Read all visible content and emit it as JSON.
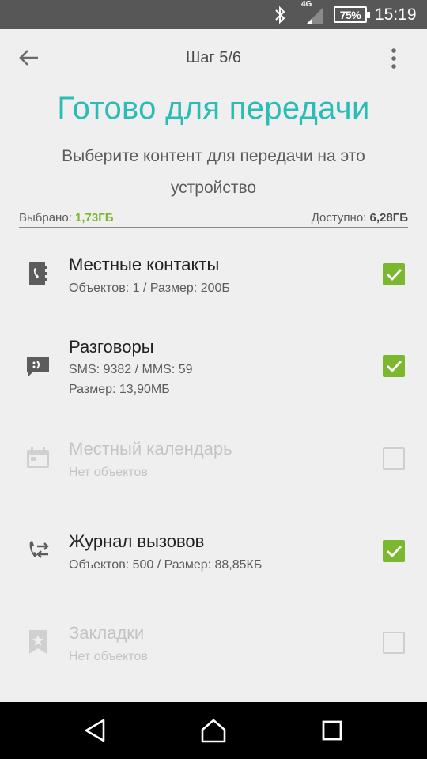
{
  "status_bar": {
    "network": "4G",
    "battery": "75%",
    "time": "15:19"
  },
  "toolbar": {
    "step": "Шаг 5/6"
  },
  "header": {
    "title": "Готово для передачи",
    "subtitle": "Выберите контент для передачи на это устройство"
  },
  "storage": {
    "selected_label": "Выбрано:",
    "selected_value": "1,73ГБ",
    "available_label": "Доступно:",
    "available_value": "6,28ГБ"
  },
  "items": [
    {
      "title": "Местные контакты",
      "sub1": "Объектов: 1 / Размер: 200Б",
      "checked": true,
      "icon": "contacts-icon"
    },
    {
      "title": "Разговоры",
      "sub1": "SMS: 9382 / MMS: 59",
      "sub2": "Размер: 13,90МБ",
      "checked": true,
      "icon": "messages-icon"
    },
    {
      "title": "Местный календарь",
      "sub1": "Нет объектов",
      "checked": false,
      "icon": "calendar-icon"
    },
    {
      "title": "Журнал вызовов",
      "sub1": "Объектов: 500 / Размер: 88,85КБ",
      "checked": true,
      "icon": "call-log-icon"
    },
    {
      "title": "Закладки",
      "sub1": "Нет объектов",
      "checked": false,
      "icon": "bookmark-icon"
    }
  ],
  "colors": {
    "accent": "#2bbcb5",
    "check_green": "#7cb82f"
  }
}
